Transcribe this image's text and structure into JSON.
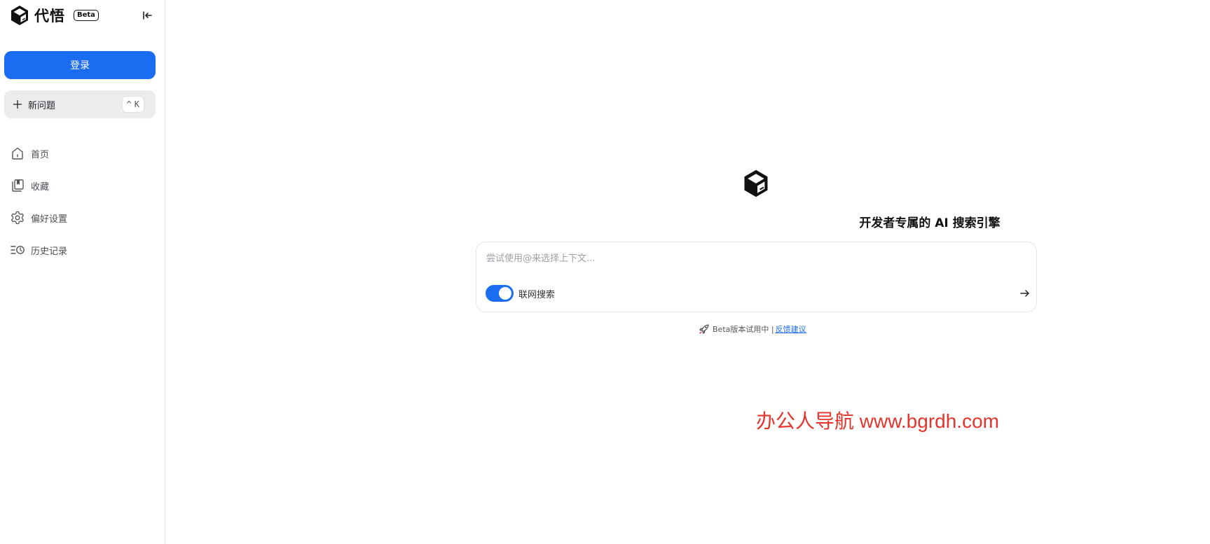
{
  "brand": {
    "name": "代悟",
    "badge": "Beta"
  },
  "sidebar": {
    "login_label": "登录",
    "new_question": {
      "label": "新问题",
      "shortcut_mod": "^",
      "shortcut_key": "K"
    },
    "items": [
      {
        "label": "首页",
        "icon": "home-icon"
      },
      {
        "label": "收藏",
        "icon": "bookmark-icon"
      },
      {
        "label": "偏好设置",
        "icon": "gear-icon"
      },
      {
        "label": "历史记录",
        "icon": "history-icon"
      }
    ]
  },
  "main": {
    "title": "开发者专属的 AI 搜索引擎",
    "search": {
      "placeholder": "尝试使用@来选择上下文...",
      "value": ""
    },
    "web_search": {
      "label": "联网搜索",
      "enabled": true
    },
    "footer": {
      "note": "Beta版本试用中 |",
      "link": "反馈建议"
    }
  },
  "watermark": "办公人导航 www.bgrdh.com",
  "colors": {
    "accent": "#1a6cf0",
    "watermark": "#e3352b"
  }
}
